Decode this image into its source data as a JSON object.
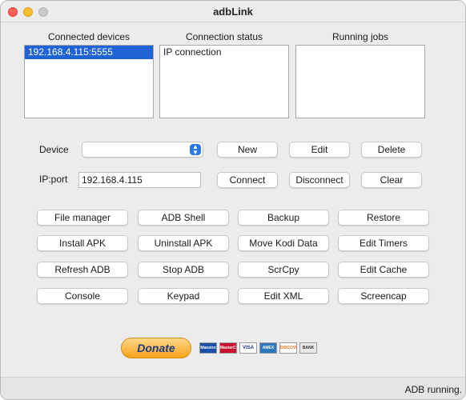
{
  "window": {
    "title": "adbLink"
  },
  "lists": {
    "connected_devices": {
      "label": "Connected devices",
      "items": [
        "192.168.4.115:5555"
      ],
      "selected": "192.168.4.115:5555"
    },
    "connection_status": {
      "label": "Connection status",
      "items": [
        "IP connection"
      ]
    },
    "running_jobs": {
      "label": "Running jobs",
      "items": []
    }
  },
  "device": {
    "label": "Device",
    "selected": ""
  },
  "ipport": {
    "label": "IP:port",
    "value": "192.168.4.115"
  },
  "device_buttons": {
    "new": "New",
    "edit": "Edit",
    "delete": "Delete"
  },
  "connection_buttons": {
    "connect": "Connect",
    "disconnect": "Disconnect",
    "clear": "Clear"
  },
  "actions": [
    [
      "File manager",
      "ADB Shell",
      "Backup",
      "Restore"
    ],
    [
      "Install APK",
      "Uninstall APK",
      "Move Kodi Data",
      "Edit Timers"
    ],
    [
      "Refresh ADB",
      "Stop ADB",
      "ScrCpy",
      "Edit Cache"
    ],
    [
      "Console",
      "Keypad",
      "Edit XML",
      "Screencap"
    ]
  ],
  "donate": {
    "label": "Donate",
    "cards": [
      {
        "name": "maestro-card-icon",
        "text": "Maestro"
      },
      {
        "name": "mastercard-icon",
        "text": "MasterCard"
      },
      {
        "name": "visa-card-icon",
        "text": "VISA"
      },
      {
        "name": "amex-card-icon",
        "text": "AMEX"
      },
      {
        "name": "discover-card-icon",
        "text": "DISCOVER"
      },
      {
        "name": "bank-icon",
        "text": "BANK"
      }
    ]
  },
  "status": {
    "text": "ADB running."
  },
  "colors": {
    "selection": "#1f63d6",
    "select_arrow": "#2b78e4",
    "close": "#ff5f57",
    "minimize": "#febc2e"
  }
}
